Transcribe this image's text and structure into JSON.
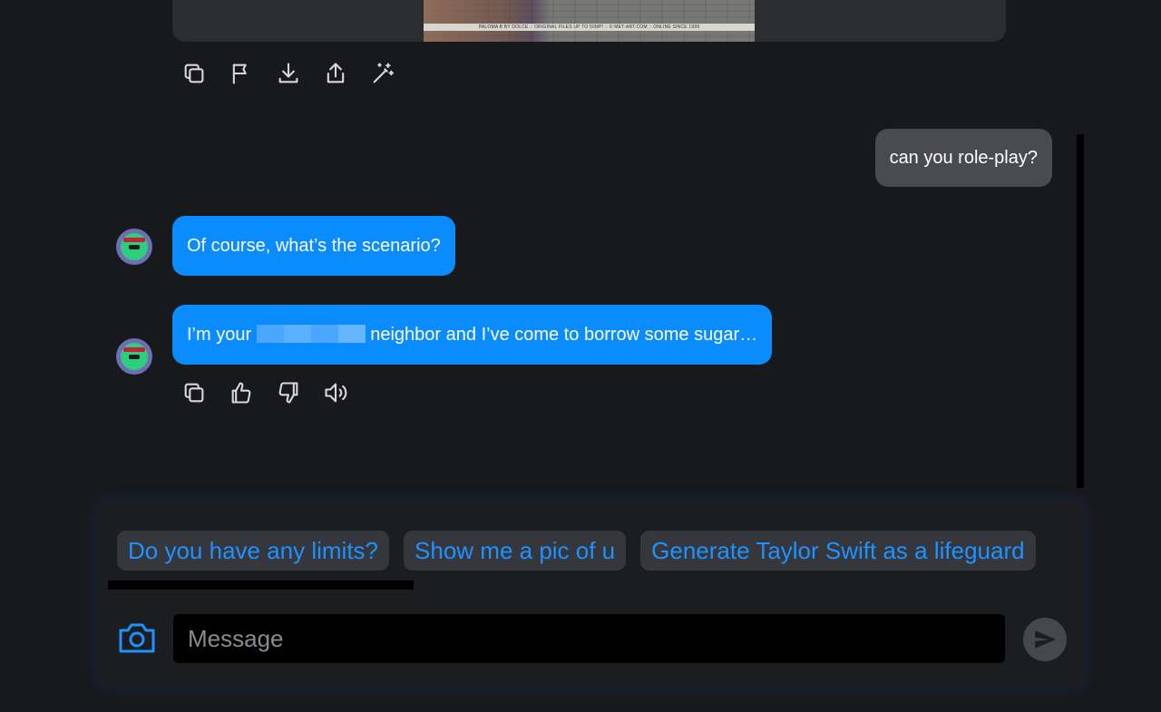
{
  "image_post": {
    "caption": "PALOMA B BY DOLCE :: ORIGINAL FILES UP TO 50MP! :: © MET-ART.COM :: ONLINE SINCE 1999"
  },
  "image_actions": [
    {
      "name": "copy-icon"
    },
    {
      "name": "flag-icon"
    },
    {
      "name": "download-icon"
    },
    {
      "name": "share-icon"
    },
    {
      "name": "magic-wand-icon"
    }
  ],
  "messages": {
    "user_1": "can you role-play?",
    "bot_1": "Of course, what’s the scenario?",
    "bot_2_prefix": "I’m your ",
    "bot_2_suffix": " neighbor and I’ve come to borrow some sugar…"
  },
  "message_actions": [
    {
      "name": "copy-icon"
    },
    {
      "name": "thumbs-up-icon"
    },
    {
      "name": "thumbs-down-icon"
    },
    {
      "name": "speaker-icon"
    }
  ],
  "suggestions": [
    "Do you have any limits?",
    "Show me a pic of u",
    "Generate Taylor Swift as a lifeguard"
  ],
  "composer": {
    "placeholder": "Message"
  },
  "colors": {
    "background": "#18191d",
    "bot_bubble": "#0a8cff",
    "user_bubble": "#4a4b50",
    "accent": "#1e92ff"
  }
}
